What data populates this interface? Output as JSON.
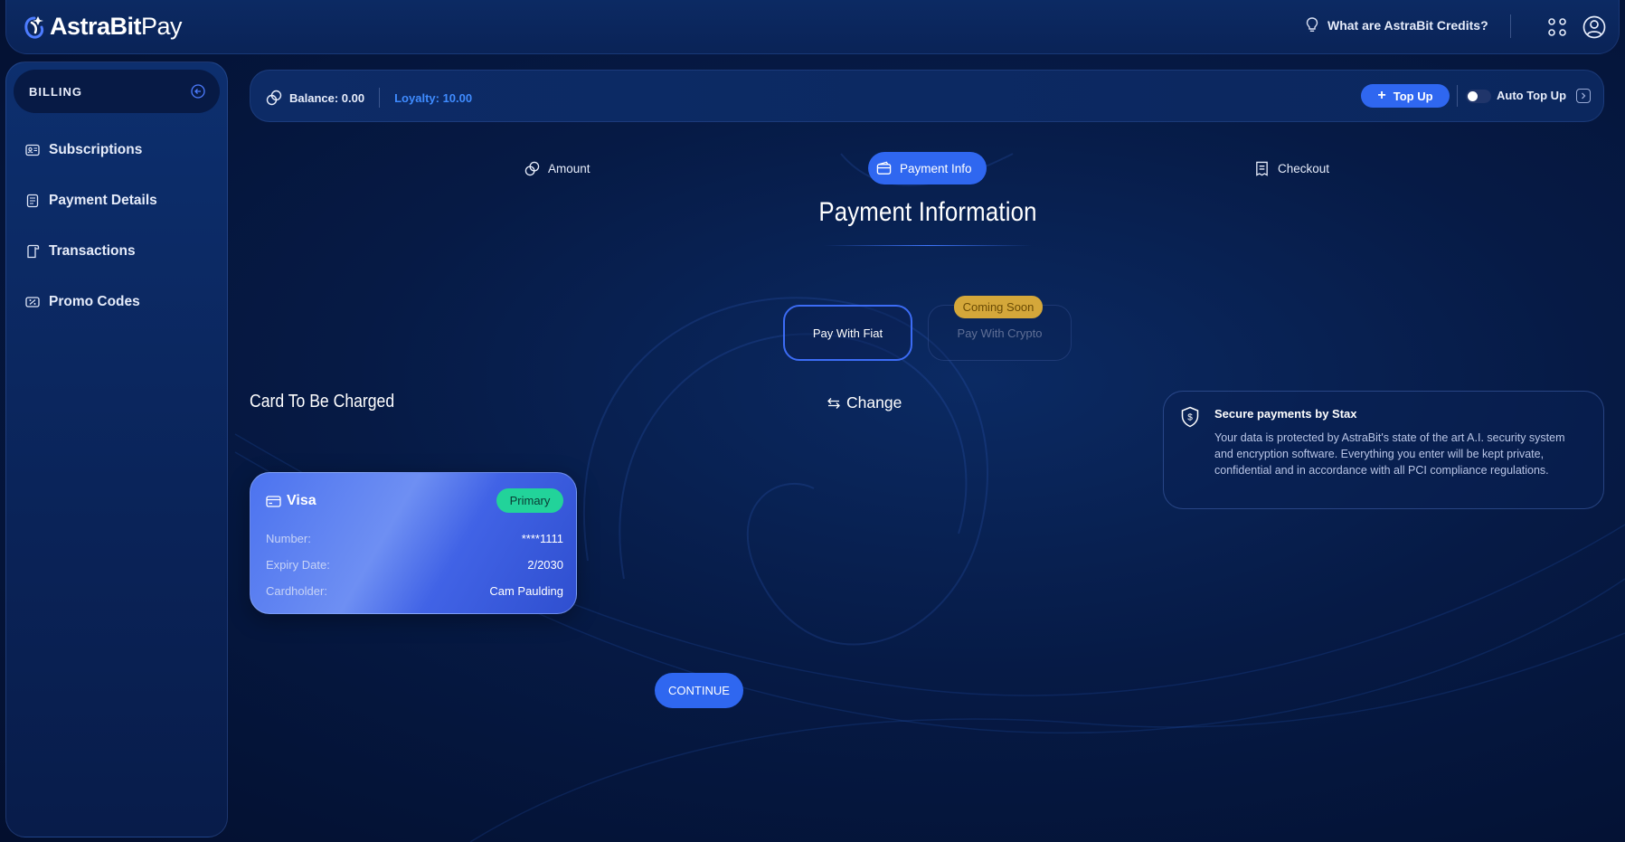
{
  "brand": {
    "name_bold": "AstraBit",
    "name_light": "Pay"
  },
  "header": {
    "credits_link": "What are AstraBit Credits?"
  },
  "sidebar": {
    "section_label": "BILLING",
    "items": [
      {
        "label": "Subscriptions",
        "icon": "id-card-icon"
      },
      {
        "label": "Payment Details",
        "icon": "document-icon"
      },
      {
        "label": "Transactions",
        "icon": "receipt-icon"
      },
      {
        "label": "Promo Codes",
        "icon": "ticket-icon"
      }
    ]
  },
  "balance_bar": {
    "balance": "Balance: 0.00",
    "loyalty": "Loyalty: 10.00",
    "topup_label": "Top Up",
    "auto_topup_label": "Auto Top Up",
    "auto_topup_enabled": false
  },
  "steps": [
    {
      "label": "Amount",
      "icon": "coins-icon",
      "active": false
    },
    {
      "label": "Payment Info",
      "icon": "wallet-icon",
      "active": true
    },
    {
      "label": "Checkout",
      "icon": "receipt-icon",
      "active": false
    }
  ],
  "page_title": "Payment Information",
  "payment_methods": {
    "fiat": "Pay With Fiat",
    "crypto": "Pay With Crypto",
    "crypto_badge": "Coming Soon"
  },
  "card_section": {
    "heading": "Card To Be Charged",
    "change_label": "Change"
  },
  "card": {
    "brand": "Visa",
    "badge": "Primary",
    "number_label": "Number:",
    "number_value": "****1111",
    "expiry_label": "Expiry Date:",
    "expiry_value": "2/2030",
    "holder_label": "Cardholder:",
    "holder_value": "Cam Paulding"
  },
  "secure": {
    "title": "Secure payments by Stax",
    "text": "Your data is protected by AstraBit's state of the art A.I. security system and encryption software. Everything you enter will be kept private, confidential and in accordance with all PCI compliance regulations."
  },
  "continue_label": "CONTINUE",
  "colors": {
    "accent": "#2f67f0",
    "loyalty": "#3f8bff",
    "primary_badge": "#22d39a",
    "coming_soon": "#d4a73a",
    "background": "#061a45"
  }
}
